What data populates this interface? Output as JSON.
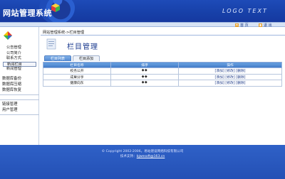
{
  "header": {
    "title": "网站管理系统",
    "logo_text": "LOGO TEXT"
  },
  "toolbar": {
    "home_label": "首 页",
    "exit_label": "退 出"
  },
  "sidebar": {
    "items": [
      {
        "label": "公告管理"
      },
      {
        "label": "公司简介"
      },
      {
        "label": "联系方式"
      },
      {
        "label": "新闻栏目"
      },
      {
        "label": "新闻管理"
      }
    ],
    "sections": [
      {
        "label": "数据库备份"
      },
      {
        "label": "数据库压缩"
      },
      {
        "label": "数据库恢复"
      }
    ],
    "bottom": [
      {
        "label": "链接管理"
      },
      {
        "label": "用户管理"
      }
    ]
  },
  "main": {
    "breadcrumb": "网站管理系统->栏目管理",
    "page_title": "栏目管理",
    "tabs": [
      {
        "label": "栏目列表"
      },
      {
        "label": "栏目添加"
      }
    ],
    "table": {
      "headers": [
        "栏目名称",
        "排序",
        "操作"
      ],
      "rows": [
        {
          "name": "校务公开",
          "order": "◆◆",
          "ops": [
            "[添加]",
            "[修改]",
            "[删除]"
          ]
        },
        {
          "name": "成果分享",
          "order": "◆◆",
          "ops": [
            "[添加]",
            "[修改]",
            "[删除]"
          ]
        },
        {
          "name": "健康向东",
          "order": "◆◆",
          "ops": [
            "[添加]",
            "[修改]",
            "[删除]"
          ]
        }
      ]
    }
  },
  "footer": {
    "copyright": "© Copyright 2002-2006，易站建设网络科技有限公司",
    "contact_prefix": "技术支持：",
    "contact_email": "bjwesoft@163.cn"
  },
  "colors": {
    "header_bg": "#1e4bb8",
    "footer_bg": "#2f61c7",
    "table_header": "#4f86d0"
  }
}
